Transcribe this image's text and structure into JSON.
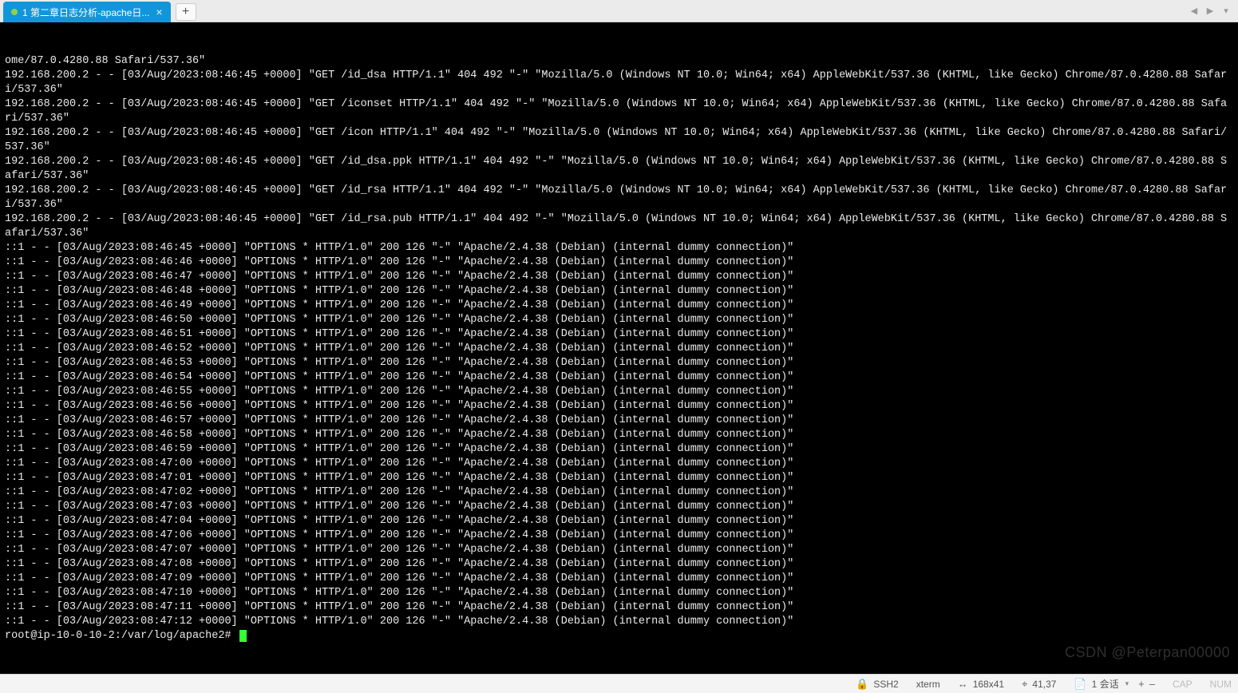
{
  "tab": {
    "title": "1 第二章日志分析-apache日..."
  },
  "terminal": {
    "logs": [
      "ome/87.0.4280.88 Safari/537.36\"",
      "192.168.200.2 - - [03/Aug/2023:08:46:45 +0000] \"GET /id_dsa HTTP/1.1\" 404 492 \"-\" \"Mozilla/5.0 (Windows NT 10.0; Win64; x64) AppleWebKit/537.36 (KHTML, like Gecko) Chrome/87.0.4280.88 Safari/537.36\"",
      "192.168.200.2 - - [03/Aug/2023:08:46:45 +0000] \"GET /iconset HTTP/1.1\" 404 492 \"-\" \"Mozilla/5.0 (Windows NT 10.0; Win64; x64) AppleWebKit/537.36 (KHTML, like Gecko) Chrome/87.0.4280.88 Safari/537.36\"",
      "192.168.200.2 - - [03/Aug/2023:08:46:45 +0000] \"GET /icon HTTP/1.1\" 404 492 \"-\" \"Mozilla/5.0 (Windows NT 10.0; Win64; x64) AppleWebKit/537.36 (KHTML, like Gecko) Chrome/87.0.4280.88 Safari/537.36\"",
      "192.168.200.2 - - [03/Aug/2023:08:46:45 +0000] \"GET /id_dsa.ppk HTTP/1.1\" 404 492 \"-\" \"Mozilla/5.0 (Windows NT 10.0; Win64; x64) AppleWebKit/537.36 (KHTML, like Gecko) Chrome/87.0.4280.88 Safari/537.36\"",
      "192.168.200.2 - - [03/Aug/2023:08:46:45 +0000] \"GET /id_rsa HTTP/1.1\" 404 492 \"-\" \"Mozilla/5.0 (Windows NT 10.0; Win64; x64) AppleWebKit/537.36 (KHTML, like Gecko) Chrome/87.0.4280.88 Safari/537.36\"",
      "192.168.200.2 - - [03/Aug/2023:08:46:45 +0000] \"GET /id_rsa.pub HTTP/1.1\" 404 492 \"-\" \"Mozilla/5.0 (Windows NT 10.0; Win64; x64) AppleWebKit/537.36 (KHTML, like Gecko) Chrome/87.0.4280.88 Safari/537.36\"",
      "::1 - - [03/Aug/2023:08:46:45 +0000] \"OPTIONS * HTTP/1.0\" 200 126 \"-\" \"Apache/2.4.38 (Debian) (internal dummy connection)\"",
      "::1 - - [03/Aug/2023:08:46:46 +0000] \"OPTIONS * HTTP/1.0\" 200 126 \"-\" \"Apache/2.4.38 (Debian) (internal dummy connection)\"",
      "::1 - - [03/Aug/2023:08:46:47 +0000] \"OPTIONS * HTTP/1.0\" 200 126 \"-\" \"Apache/2.4.38 (Debian) (internal dummy connection)\"",
      "::1 - - [03/Aug/2023:08:46:48 +0000] \"OPTIONS * HTTP/1.0\" 200 126 \"-\" \"Apache/2.4.38 (Debian) (internal dummy connection)\"",
      "::1 - - [03/Aug/2023:08:46:49 +0000] \"OPTIONS * HTTP/1.0\" 200 126 \"-\" \"Apache/2.4.38 (Debian) (internal dummy connection)\"",
      "::1 - - [03/Aug/2023:08:46:50 +0000] \"OPTIONS * HTTP/1.0\" 200 126 \"-\" \"Apache/2.4.38 (Debian) (internal dummy connection)\"",
      "::1 - - [03/Aug/2023:08:46:51 +0000] \"OPTIONS * HTTP/1.0\" 200 126 \"-\" \"Apache/2.4.38 (Debian) (internal dummy connection)\"",
      "::1 - - [03/Aug/2023:08:46:52 +0000] \"OPTIONS * HTTP/1.0\" 200 126 \"-\" \"Apache/2.4.38 (Debian) (internal dummy connection)\"",
      "::1 - - [03/Aug/2023:08:46:53 +0000] \"OPTIONS * HTTP/1.0\" 200 126 \"-\" \"Apache/2.4.38 (Debian) (internal dummy connection)\"",
      "::1 - - [03/Aug/2023:08:46:54 +0000] \"OPTIONS * HTTP/1.0\" 200 126 \"-\" \"Apache/2.4.38 (Debian) (internal dummy connection)\"",
      "::1 - - [03/Aug/2023:08:46:55 +0000] \"OPTIONS * HTTP/1.0\" 200 126 \"-\" \"Apache/2.4.38 (Debian) (internal dummy connection)\"",
      "::1 - - [03/Aug/2023:08:46:56 +0000] \"OPTIONS * HTTP/1.0\" 200 126 \"-\" \"Apache/2.4.38 (Debian) (internal dummy connection)\"",
      "::1 - - [03/Aug/2023:08:46:57 +0000] \"OPTIONS * HTTP/1.0\" 200 126 \"-\" \"Apache/2.4.38 (Debian) (internal dummy connection)\"",
      "::1 - - [03/Aug/2023:08:46:58 +0000] \"OPTIONS * HTTP/1.0\" 200 126 \"-\" \"Apache/2.4.38 (Debian) (internal dummy connection)\"",
      "::1 - - [03/Aug/2023:08:46:59 +0000] \"OPTIONS * HTTP/1.0\" 200 126 \"-\" \"Apache/2.4.38 (Debian) (internal dummy connection)\"",
      "::1 - - [03/Aug/2023:08:47:00 +0000] \"OPTIONS * HTTP/1.0\" 200 126 \"-\" \"Apache/2.4.38 (Debian) (internal dummy connection)\"",
      "::1 - - [03/Aug/2023:08:47:01 +0000] \"OPTIONS * HTTP/1.0\" 200 126 \"-\" \"Apache/2.4.38 (Debian) (internal dummy connection)\"",
      "::1 - - [03/Aug/2023:08:47:02 +0000] \"OPTIONS * HTTP/1.0\" 200 126 \"-\" \"Apache/2.4.38 (Debian) (internal dummy connection)\"",
      "::1 - - [03/Aug/2023:08:47:03 +0000] \"OPTIONS * HTTP/1.0\" 200 126 \"-\" \"Apache/2.4.38 (Debian) (internal dummy connection)\"",
      "::1 - - [03/Aug/2023:08:47:04 +0000] \"OPTIONS * HTTP/1.0\" 200 126 \"-\" \"Apache/2.4.38 (Debian) (internal dummy connection)\"",
      "::1 - - [03/Aug/2023:08:47:06 +0000] \"OPTIONS * HTTP/1.0\" 200 126 \"-\" \"Apache/2.4.38 (Debian) (internal dummy connection)\"",
      "::1 - - [03/Aug/2023:08:47:07 +0000] \"OPTIONS * HTTP/1.0\" 200 126 \"-\" \"Apache/2.4.38 (Debian) (internal dummy connection)\"",
      "::1 - - [03/Aug/2023:08:47:08 +0000] \"OPTIONS * HTTP/1.0\" 200 126 \"-\" \"Apache/2.4.38 (Debian) (internal dummy connection)\"",
      "::1 - - [03/Aug/2023:08:47:09 +0000] \"OPTIONS * HTTP/1.0\" 200 126 \"-\" \"Apache/2.4.38 (Debian) (internal dummy connection)\"",
      "::1 - - [03/Aug/2023:08:47:10 +0000] \"OPTIONS * HTTP/1.0\" 200 126 \"-\" \"Apache/2.4.38 (Debian) (internal dummy connection)\"",
      "::1 - - [03/Aug/2023:08:47:11 +0000] \"OPTIONS * HTTP/1.0\" 200 126 \"-\" \"Apache/2.4.38 (Debian) (internal dummy connection)\"",
      "::1 - - [03/Aug/2023:08:47:12 +0000] \"OPTIONS * HTTP/1.0\" 200 126 \"-\" \"Apache/2.4.38 (Debian) (internal dummy connection)\""
    ],
    "prompt": "root@ip-10-0-10-2:/var/log/apache2# ",
    "watermark": "CSDN @Peterpan00000"
  },
  "statusbar": {
    "protocol": "SSH2",
    "termtype": "xterm",
    "size": "168x41",
    "cursor": "41,37",
    "session_label": "1 会话",
    "caps": "CAP",
    "num": "NUM"
  }
}
